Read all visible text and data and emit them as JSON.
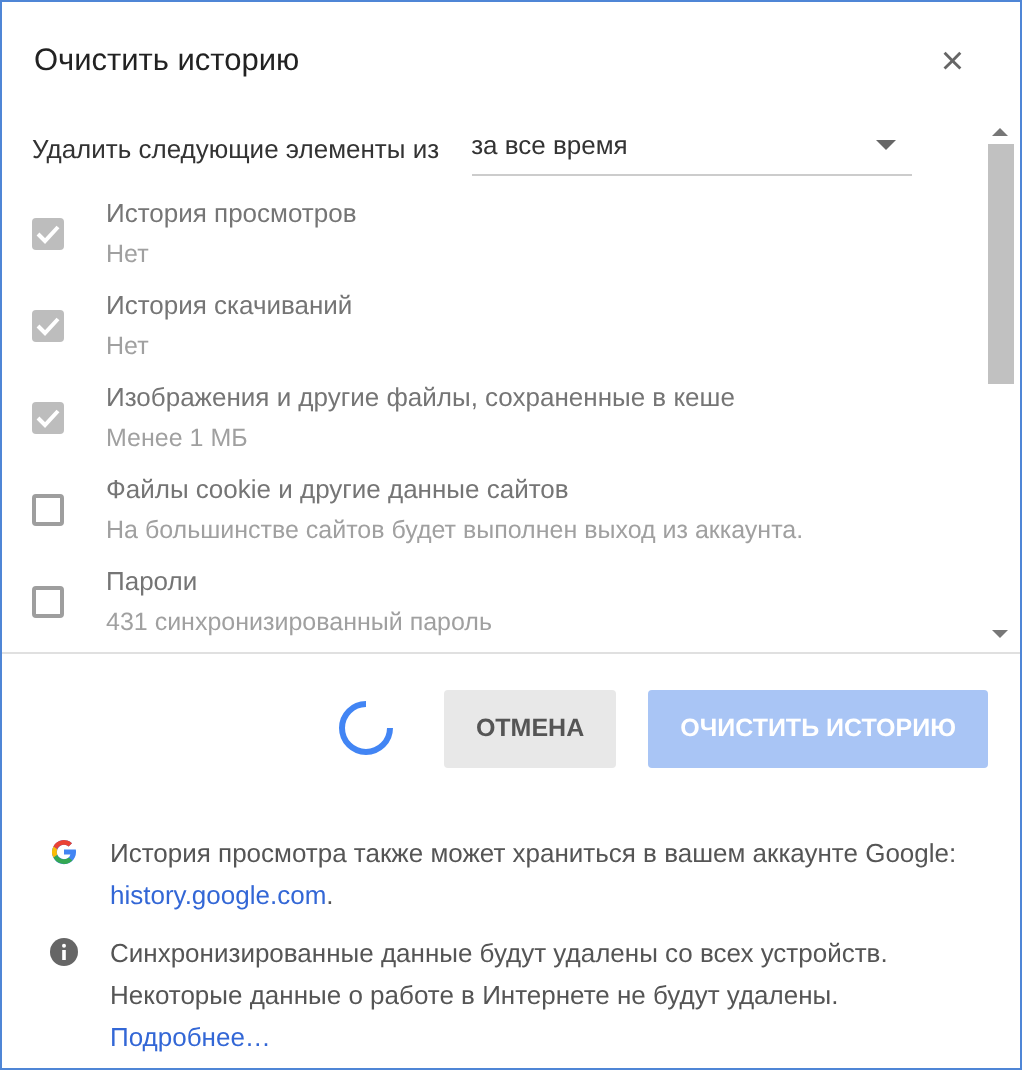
{
  "dialog": {
    "title": "Очистить историю",
    "close": "×"
  },
  "period": {
    "label": "Удалить следующие элементы из",
    "value": "за все время"
  },
  "items": [
    {
      "label": "История просмотров",
      "detail": "Нет",
      "checked": true
    },
    {
      "label": "История скачиваний",
      "detail": "Нет",
      "checked": true
    },
    {
      "label": "Изображения и другие файлы, сохраненные в кеше",
      "detail": "Менее 1 МБ",
      "checked": true
    },
    {
      "label": "Файлы cookie и другие данные сайтов",
      "detail": "На большинстве сайтов будет выполнен выход из аккаунта.",
      "checked": false
    },
    {
      "label": "Пароли",
      "detail": "431 синхронизированный пароль",
      "checked": false
    }
  ],
  "busy": true,
  "buttons": [
    {
      "kind": "cancel",
      "label": "ОТМЕНА"
    },
    {
      "kind": "primary",
      "label": "ОЧИСТИТЬ ИСТОРИЮ",
      "disabled": true
    }
  ],
  "notes": [
    {
      "kind": "google",
      "text": "История просмотра также может храниться в вашем аккаунте Google:",
      "link": "history.google.com",
      "after": "."
    },
    {
      "kind": "info",
      "text": "Синхронизированные данные будут удалены со всех устройств. Некоторые данные о работе в Интернете не будут удалены.",
      "link": "Подробнее…"
    }
  ]
}
